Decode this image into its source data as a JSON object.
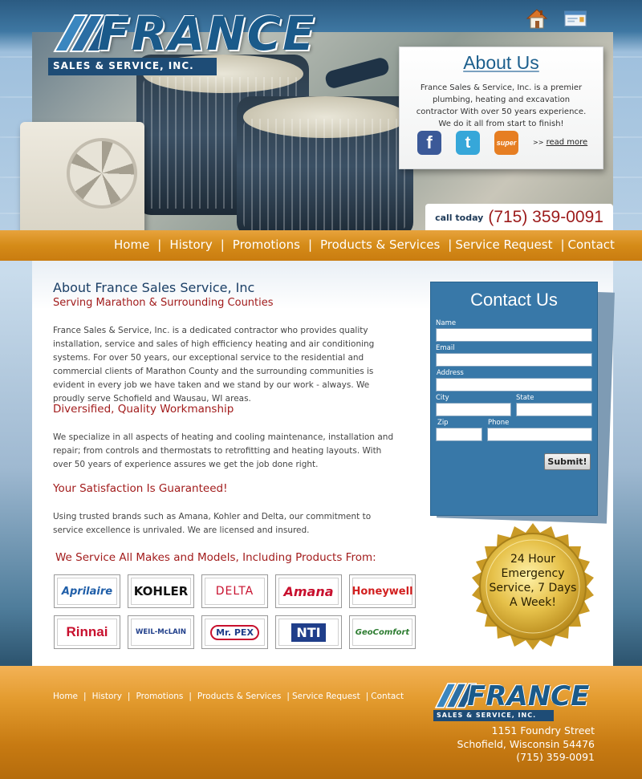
{
  "header": {
    "logo_text": "FRANCE",
    "logo_sub": "SALES & SERVICE, INC.",
    "icons": [
      "home-icon",
      "mail-icon"
    ]
  },
  "about_box": {
    "title": "About Us",
    "body": "France Sales & Service, Inc. is a premier plumbing, heating and excavation contractor With over 50 years experience. We do it all from start to finish!",
    "social": [
      {
        "name": "facebook-icon",
        "glyph": "f",
        "color": "#3b5998"
      },
      {
        "name": "twitter-icon",
        "glyph": "t",
        "color": "#36a7d9"
      },
      {
        "name": "superpages-icon",
        "glyph": "super",
        "color": "#e67e22"
      }
    ],
    "read_more_prefix": ">>",
    "read_more": "read more"
  },
  "call": {
    "label": "call today",
    "phone": "(715) 359-0091"
  },
  "nav": {
    "items": [
      "Home",
      "History",
      "Promotions",
      "Products & Services",
      "Service Request",
      "Contact"
    ],
    "separator": "|"
  },
  "main": {
    "title": "About France Sales Service, Inc",
    "tagline": "Serving Marathon & Surrounding Counties",
    "intro": "France Sales & Service, Inc. is a dedicated contractor who provides quality installation, service and sales of high efficiency heating and air conditioning systems. For over 50 years, our exceptional service to the residential and commercial clients of Marathon County and the surrounding communities is evident in every job we have taken and we stand by our work - always. We proudly serve Schofield and Wausau, WI areas.",
    "section1_title": "Diversified, Quality Workmanship",
    "section1_body": "We specialize in all aspects of heating and cooling maintenance, installation and repair; from controls and thermostats to retrofitting and heating layouts. With over 50 years of experience assures we get the job done right.",
    "section2_title": "Your Satisfaction Is Guaranteed!",
    "section2_body": "Using trusted brands such as Amana, Kohler and Delta, our commitment to service excellence is unrivaled. We are licensed and insured.",
    "brands_title": "We Service All Makes and Models, Including Products From:",
    "brands_row1": [
      {
        "text": "Aprilaire",
        "color": "#1f5ea8"
      },
      {
        "text": "KOHLER",
        "color": "#111111"
      },
      {
        "text": "DELTA",
        "color": "#c8102e"
      },
      {
        "text": "Amana",
        "color": "#c8102e"
      },
      {
        "text": "Honeywell",
        "color": "#d21f1f"
      }
    ],
    "brands_row2": [
      {
        "text": "Rinnai",
        "color": "#c8102e"
      },
      {
        "text": "WEIL-McLAIN",
        "color": "#1f3e8a"
      },
      {
        "text": "Mr. PEX",
        "color": "#1f3e8a"
      },
      {
        "text": "NTI",
        "color": "#1f3e8a"
      },
      {
        "text": "GeoComfort",
        "color": "#2e7d32"
      }
    ]
  },
  "contact": {
    "title": "Contact Us",
    "fields": {
      "name": "Name",
      "email": "Email",
      "address": "Address",
      "city": "City",
      "state": "State",
      "zip": "Zip",
      "phone": "Phone"
    },
    "submit": "Submit!"
  },
  "seal": {
    "line1": "24 Hour",
    "line2": "Emergency",
    "line3": "Service, 7 Days",
    "line4": "A Week!"
  },
  "footer": {
    "links": [
      "Home",
      "History",
      "Promotions",
      "Products & Services",
      "Service Request",
      "Contact"
    ],
    "separator": "|",
    "logo_text": "FRANCE",
    "logo_sub": "SALES & SERVICE, INC.",
    "address_line1": "1151 Foundry Street",
    "address_line2": "Schofield, Wisconsin 54476",
    "address_line3": "(715) 359-0091"
  }
}
